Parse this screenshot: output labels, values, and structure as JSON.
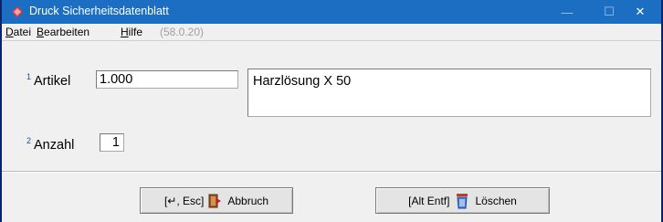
{
  "window": {
    "title": "Druck Sicherheitsdatenblatt",
    "controls": {
      "minimize": "—",
      "maximize": "☐",
      "close": "✕"
    }
  },
  "menu": {
    "items": [
      {
        "label": "Datei",
        "accel": "D",
        "rest": "atei"
      },
      {
        "label": "Bearbeiten",
        "accel": "B",
        "rest": "earbeiten"
      },
      {
        "label": "Hilfe",
        "accel": "H",
        "rest": "ilfe"
      }
    ],
    "version": "(58.0.20)"
  },
  "form": {
    "artikel": {
      "index": "1",
      "label": "Artikel",
      "value": "1.000"
    },
    "description": "Harzlösung X 50",
    "anzahl": {
      "index": "2",
      "label": "Anzahl",
      "value": "1"
    }
  },
  "buttons": {
    "abbruch": {
      "shortcut": "[↵, Esc]",
      "label": "Abbruch",
      "icon": "exit-door-icon"
    },
    "loeschen": {
      "shortcut": "[Alt Entf]",
      "label": "Löschen",
      "icon": "trash-can-icon"
    }
  },
  "colors": {
    "titlebar": "#1b6ec2",
    "index_superscript": "#1a4fa3",
    "version_text": "#a0a0a0"
  }
}
